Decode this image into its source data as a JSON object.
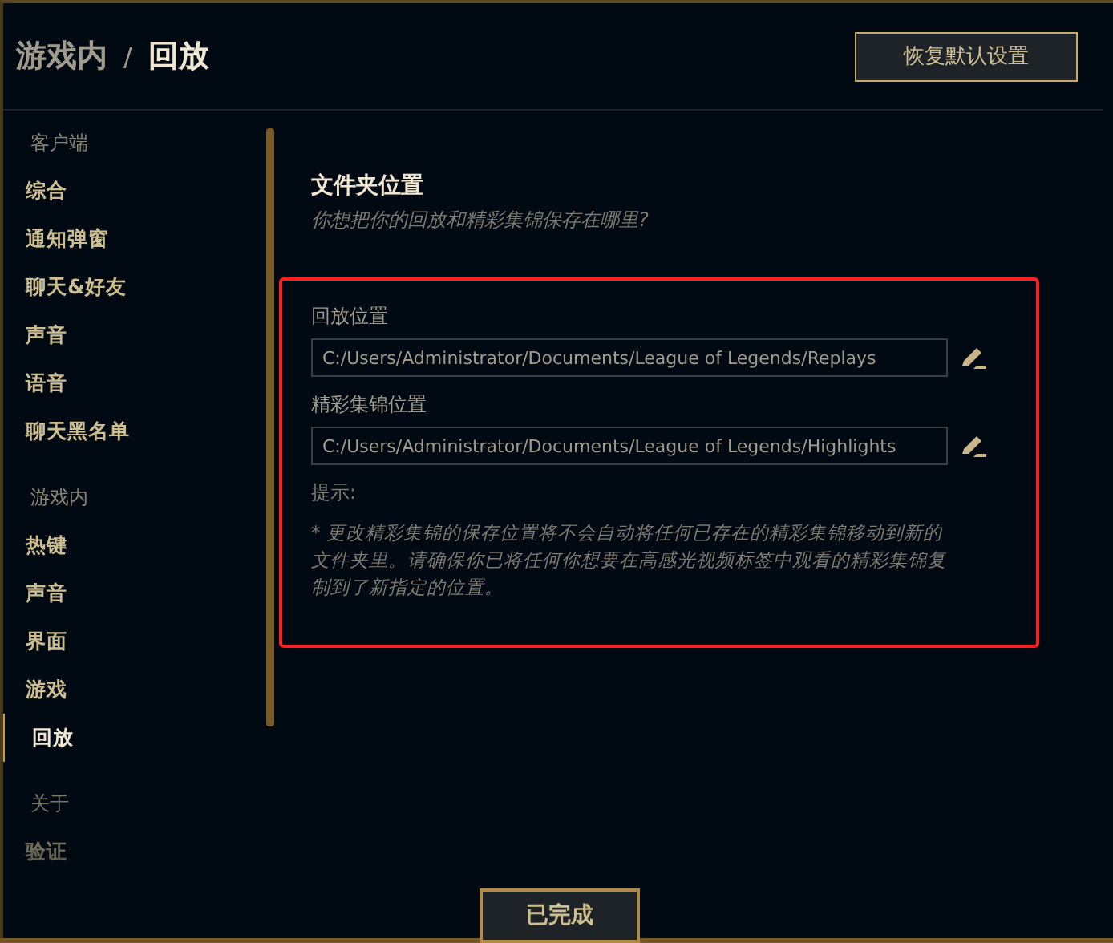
{
  "header": {
    "breadcrumb_parent": "游戏内",
    "separator": "/",
    "title": "回放",
    "reset_button": "恢复默认设置"
  },
  "sidebar": {
    "groups": [
      {
        "label": "客户端",
        "items": [
          {
            "label": "综合",
            "selected": false
          },
          {
            "label": "通知弹窗",
            "selected": false
          },
          {
            "label": "聊天&好友",
            "selected": false
          },
          {
            "label": "声音",
            "selected": false
          },
          {
            "label": "语音",
            "selected": false
          },
          {
            "label": "聊天黑名单",
            "selected": false
          }
        ]
      },
      {
        "label": "游戏内",
        "items": [
          {
            "label": "热键",
            "selected": false
          },
          {
            "label": "声音",
            "selected": false
          },
          {
            "label": "界面",
            "selected": false
          },
          {
            "label": "游戏",
            "selected": false
          },
          {
            "label": "回放",
            "selected": true
          }
        ]
      },
      {
        "label": "关于",
        "items": [
          {
            "label": "验证",
            "selected": false
          }
        ]
      }
    ]
  },
  "section": {
    "title": "文件夹位置",
    "subtitle": "你想把你的回放和精彩集锦保存在哪里?",
    "highlighted": true,
    "fields": [
      {
        "label": "回放位置",
        "value": "C:/Users/Administrator/Documents/League of Legends/Replays"
      },
      {
        "label": "精彩集锦位置",
        "value": "C:/Users/Administrator/Documents/League of Legends/Highlights"
      }
    ],
    "hint_label": "提示:",
    "hint": "* 更改精彩集锦的保存位置将不会自动将任何已存在的精彩集锦移动到新的文件夹里。请确保你已将任何你想要在高感光视频标签中观看的精彩集锦复制到了新指定的位置。"
  },
  "done_button": "已完成"
}
